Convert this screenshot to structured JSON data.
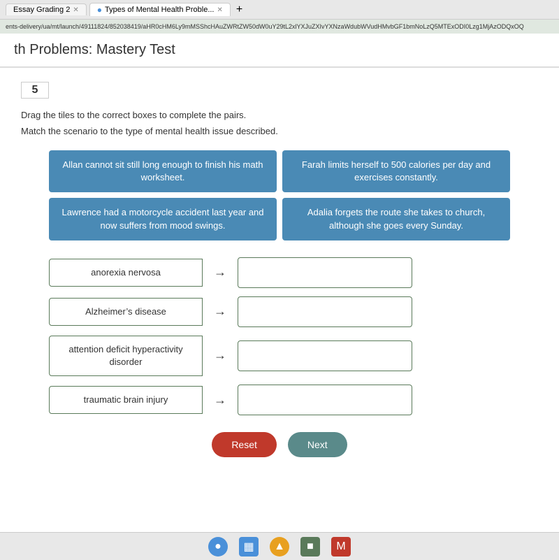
{
  "browser": {
    "tabs": [
      {
        "label": "Essay Grading 2",
        "active": false
      },
      {
        "label": "Types of Mental Health Proble...",
        "active": true
      }
    ],
    "url": "ents-delivery/ua/mt/launch/49111824/852038419/aHR0cHM6Ly9mMSShcHAuZWRtZW50dW0uY29tL2xlYXJuZXIvYXNzaWdubWVudHMvbGF1bmNoLzQ5MTExODI0Lzg1MjAzODQxOQ"
  },
  "page": {
    "title": "th Problems: Mastery Test"
  },
  "question": {
    "number": "5",
    "instruction1": "Drag the tiles to the correct boxes to complete the pairs.",
    "instruction2": "Match the scenario to the type of mental health issue described."
  },
  "scenario_tiles": [
    {
      "id": "tile1",
      "text": "Allan cannot sit still long enough to finish his math worksheet."
    },
    {
      "id": "tile2",
      "text": "Farah limits herself to 500 calories per day and exercises constantly."
    },
    {
      "id": "tile3",
      "text": "Lawrence had a motorcycle accident last year and now suffers from mood swings."
    },
    {
      "id": "tile4",
      "text": "Adalia forgets the route she takes to church, although she goes every Sunday."
    }
  ],
  "match_rows": [
    {
      "id": "row1",
      "label": "anorexia nervosa",
      "drop_value": ""
    },
    {
      "id": "row2",
      "label": "Alzheimer’s disease",
      "drop_value": ""
    },
    {
      "id": "row3",
      "label": "attention deficit hyperactivity disorder",
      "drop_value": ""
    },
    {
      "id": "row4",
      "label": "traumatic brain injury",
      "drop_value": ""
    }
  ],
  "buttons": {
    "reset": "Reset",
    "next": "Next"
  },
  "icons": {
    "chrome": "🔵",
    "calendar": "📅",
    "shield": "🛡",
    "folder": "📁",
    "mail": "✉"
  }
}
